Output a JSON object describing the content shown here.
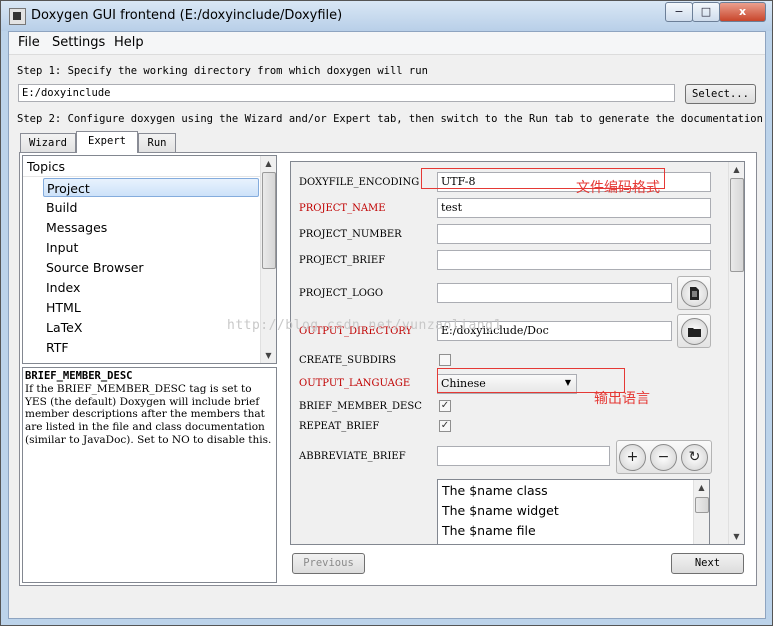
{
  "window": {
    "title": "Doxygen GUI frontend (E:/doxyinclude/Doxyfile)",
    "minimize_glyph": "−",
    "maximize_glyph": "□",
    "close_glyph": "x"
  },
  "menubar": {
    "items": [
      "File",
      "Settings",
      "Help"
    ]
  },
  "step1": {
    "text": "Step 1: Specify the working directory from which doxygen will run",
    "path": "E:/doxyinclude",
    "select_label": "Select..."
  },
  "step2": {
    "text": "Step 2: Configure doxygen using the Wizard and/or Expert tab, then switch to the Run tab to generate the documentation"
  },
  "tabs": [
    "Wizard",
    "Expert",
    "Run"
  ],
  "topics": {
    "header": "Topics",
    "items": [
      "Project",
      "Build",
      "Messages",
      "Input",
      "Source Browser",
      "Index",
      "HTML",
      "LaTeX",
      "RTF"
    ],
    "selected": "Project"
  },
  "help": {
    "title": "BRIEF_MEMBER_DESC",
    "body": "If the BRIEF_MEMBER_DESC tag is set to YES (the default) Doxygen will include brief member descriptions after the members that are listed in the file and class documentation (similar to JavaDoc). Set to NO to disable this."
  },
  "settings": {
    "doxyfile_encoding": {
      "label": "DOXYFILE_ENCODING",
      "value": "UTF-8"
    },
    "project_name": {
      "label": "PROJECT_NAME",
      "value": "test"
    },
    "project_number": {
      "label": "PROJECT_NUMBER",
      "value": ""
    },
    "project_brief": {
      "label": "PROJECT_BRIEF",
      "value": ""
    },
    "project_logo": {
      "label": "PROJECT_LOGO",
      "value": ""
    },
    "output_directory": {
      "label": "OUTPUT_DIRECTORY",
      "value": "E:/doxyinclude/Doc"
    },
    "create_subdirs": {
      "label": "CREATE_SUBDIRS",
      "checked": false
    },
    "output_language": {
      "label": "OUTPUT_LANGUAGE",
      "value": "Chinese"
    },
    "brief_member_desc": {
      "label": "BRIEF_MEMBER_DESC",
      "checked": true
    },
    "repeat_brief": {
      "label": "REPEAT_BRIEF",
      "checked": true
    },
    "abbreviate_brief": {
      "label": "ABBREVIATE_BRIEF",
      "value": "",
      "list": [
        "The $name class",
        "The $name widget",
        "The $name file"
      ]
    }
  },
  "icons": {
    "file_icon": "file-icon",
    "folder_icon": "folder-icon",
    "add_glyph": "+",
    "remove_glyph": "−",
    "refresh_glyph": "↻",
    "check_glyph": "✓",
    "up_arrow": "▲",
    "down_arrow": "▼"
  },
  "annotations": {
    "encoding_note": "文件编码格式",
    "language_note": "输出语言",
    "watermark": "http://blog.csdn.net/yunzaoliang1"
  },
  "nav": {
    "previous_label": "Previous",
    "next_label": "Next"
  },
  "colors": {
    "required_label": "#c00000",
    "annotation": "#e53935"
  }
}
